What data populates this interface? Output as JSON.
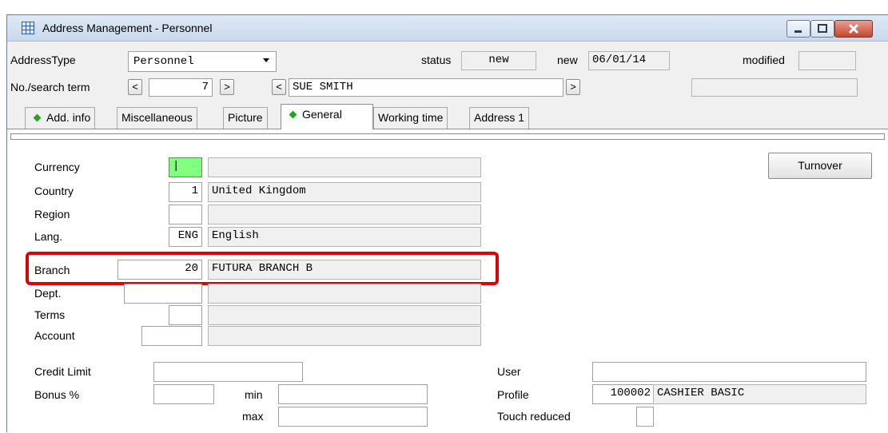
{
  "window": {
    "title": "Address Management - Personnel"
  },
  "header": {
    "address_type_label": "AddressType",
    "address_type_value": "Personnel",
    "status_label": "status",
    "status_value": "new",
    "new_label": "new",
    "new_date": "06/01/14",
    "modified_label": "modified",
    "modified_value": "",
    "search_label": "No./search term",
    "prev_symbol": "<",
    "next_symbol": ">",
    "number_value": "7",
    "name_value": "SUE SMITH",
    "right_field_value": ""
  },
  "tabs": [
    {
      "label": "Add. info",
      "marker": true
    },
    {
      "label": "Miscellaneous",
      "marker": false
    },
    {
      "label": "Picture",
      "marker": false
    },
    {
      "label": "General",
      "marker": true
    },
    {
      "label": "Working time",
      "marker": false
    },
    {
      "label": "Address 1",
      "marker": false
    }
  ],
  "active_tab": "General",
  "form": {
    "currency": {
      "label": "Currency",
      "code": "|",
      "text": ""
    },
    "country": {
      "label": "Country",
      "code": "1",
      "text": "United Kingdom"
    },
    "region": {
      "label": "Region",
      "code": "",
      "text": ""
    },
    "lang": {
      "label": "Lang.",
      "code": "ENG",
      "text": "English"
    },
    "branch": {
      "label": "Branch",
      "code": "20",
      "text": "FUTURA BRANCH B"
    },
    "dept": {
      "label": "Dept.",
      "code": "",
      "text": ""
    },
    "terms": {
      "label": "Terms",
      "code": "",
      "text": ""
    },
    "account": {
      "label": "Account",
      "code": "",
      "text": ""
    },
    "credit_limit": {
      "label": "Credit Limit",
      "value": ""
    },
    "bonus": {
      "label": "Bonus %",
      "value": "",
      "min_label": "min",
      "min_value": "",
      "max_label": "max",
      "max_value": ""
    },
    "user": {
      "label": "User",
      "value": ""
    },
    "profile": {
      "label": "Profile",
      "code": "100002",
      "text": "CASHIER BASIC"
    },
    "touch_reduced": {
      "label": "Touch reduced",
      "value": ""
    }
  },
  "buttons": {
    "turnover_label": "Turnover"
  },
  "colors": {
    "highlight": "#e30000",
    "currency_active": "#80ff80",
    "tab_marker": "#1fa81f"
  }
}
